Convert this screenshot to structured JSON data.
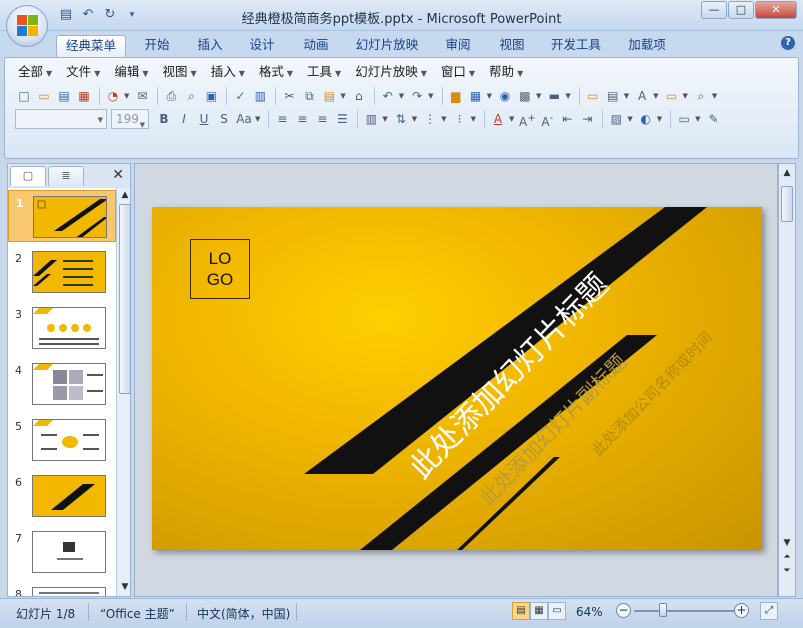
{
  "window": {
    "title": "经典橙极简商务ppt模板.pptx - Microsoft PowerPoint",
    "minimize_glyph": "—",
    "maximize_glyph": "□",
    "close_glyph": "✕"
  },
  "quick_access": [
    {
      "name": "save-icon",
      "glyph": "▤"
    },
    {
      "name": "undo-icon",
      "glyph": "↶"
    },
    {
      "name": "redo-icon",
      "glyph": "↻"
    },
    {
      "name": "customize-qat-icon",
      "glyph": "▾"
    }
  ],
  "ribbon_tabs": [
    "经典菜单",
    "开始",
    "插入",
    "设计",
    "动画",
    "幻灯片放映",
    "审阅",
    "视图",
    "开发工具",
    "加载项"
  ],
  "active_tab": "经典菜单",
  "help_glyph": "?",
  "menu_bar": [
    "全部",
    "文件",
    "编辑",
    "视图",
    "插入",
    "格式",
    "工具",
    "幻灯片放映",
    "窗口",
    "帮助"
  ],
  "font_size_value": "199",
  "left_panel": {
    "tab_slides_glyph": "▢",
    "tab_outline_glyph": "≣",
    "close_glyph": "✕",
    "slides": [
      {
        "num": "1",
        "kind": "title"
      },
      {
        "num": "2",
        "kind": "agenda"
      },
      {
        "num": "3",
        "kind": "circles"
      },
      {
        "num": "4",
        "kind": "photos"
      },
      {
        "num": "5",
        "kind": "diagram"
      },
      {
        "num": "6",
        "kind": "section"
      },
      {
        "num": "7",
        "kind": "logo"
      },
      {
        "num": "8",
        "kind": "text"
      }
    ],
    "selected": "1"
  },
  "slide": {
    "logo_line1": "LO",
    "logo_line2": "GO",
    "title": "此处添加幻灯片标题",
    "subtitle": "此处添加幻灯片副标题",
    "company": "此处添加公司名称或时间"
  },
  "status": {
    "slide_info": "幻灯片 1/8",
    "theme": "“Office 主题”",
    "language": "中文(简体，中国)",
    "zoom": "64%",
    "zoom_fraction": 0.28
  },
  "colors": {
    "accent_yellow": "#f2b800",
    "band_black": "#111111",
    "selected_thumb": "#f8c76e"
  }
}
